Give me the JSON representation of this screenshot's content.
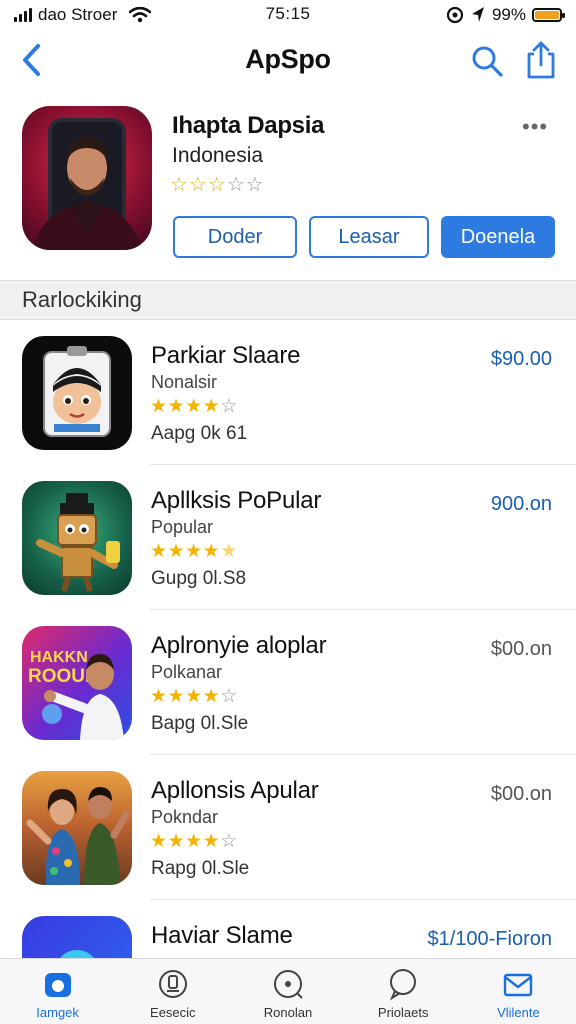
{
  "status_bar": {
    "carrier": "dao Stroer",
    "time": "75:15",
    "battery": "99%",
    "battery_level": 0.99
  },
  "nav": {
    "title": "ApSpo"
  },
  "featured": {
    "name": "Ihapta Dapsia",
    "subtitle": "Indonesia",
    "stars": "☆☆☆☆☆",
    "rating": 3,
    "more": "•••",
    "buttons": {
      "first": "Doder",
      "second": "Leasar",
      "third": "Doenela"
    }
  },
  "section": {
    "title": "Rarlockiking"
  },
  "apps": [
    {
      "name": "Parkiar Slaare",
      "category": "Nonalsir",
      "rating": 4,
      "meta": "Aapg 0k 61",
      "price": "$90.00",
      "price_color": "#1a5fb4"
    },
    {
      "name": "Apllksis PoPular",
      "category": "Popular",
      "rating": 4.5,
      "meta": "Gupg 0l.S8",
      "price": "900.on",
      "price_color": "#1a5fb4"
    },
    {
      "name": "Aplronyie aloplar",
      "category": "Polkanar",
      "rating": 4,
      "meta": "Bapg 0l.Sle",
      "price": "$00.on",
      "price_color": "#555555"
    },
    {
      "name": "Apllonsis Apular",
      "category": "Pokndar",
      "rating": 4,
      "meta": "Rapg 0l.Sle",
      "price": "$00.on",
      "price_color": "#555555"
    },
    {
      "name": "Haviar Slame",
      "category": "",
      "rating": 0,
      "meta": "",
      "price": "$1/100-Fioron",
      "price_color": "#1a5fb4"
    }
  ],
  "tabs": [
    {
      "label": "Iamgek",
      "icon": "home-icon",
      "active": true
    },
    {
      "label": "Eesecic",
      "icon": "badge-icon",
      "active": false
    },
    {
      "label": "Ronolan",
      "icon": "location-icon",
      "active": false
    },
    {
      "label": "Priolaets",
      "icon": "chat-icon",
      "active": false
    },
    {
      "label": "Vlilente",
      "icon": "mail-icon",
      "active": false
    }
  ],
  "colors": {
    "accent": "#2d7be0",
    "star": "#f5b301"
  }
}
